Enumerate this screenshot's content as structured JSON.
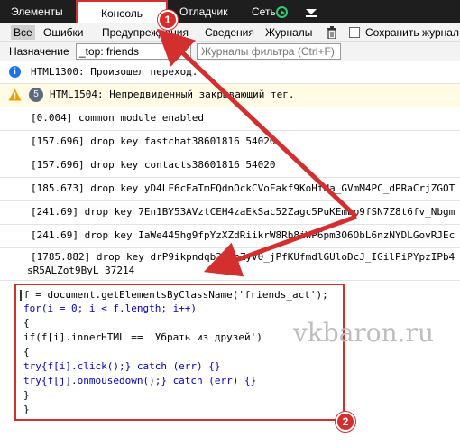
{
  "tabs": {
    "elements": "Элементы",
    "console": "Консоль",
    "debugger": "Отладчик",
    "network": "Сеть"
  },
  "filters": {
    "all": "Все",
    "errors": "Ошибки",
    "warnings": "Предупреждения",
    "info": "Сведения",
    "logs": "Журналы",
    "preserve_log": "Сохранить журнал"
  },
  "target": {
    "label": "Назначение",
    "selected": "_top: friends",
    "filter_placeholder": "Журналы фильтра (Ctrl+F)"
  },
  "messages": [
    {
      "level": "info",
      "text": "HTML1300: Произошел переход."
    },
    {
      "level": "warning",
      "count": "5",
      "text": "HTML1504: Непредвиденный закрывающий тег."
    },
    {
      "text": "[0.004]  common module enabled"
    },
    {
      "text": "[157.696]  drop key fastchat38601816 54020"
    },
    {
      "text": "[157.696]  drop key contacts38601816 54020"
    },
    {
      "text": "[185.673]  drop key yD4LF6cEaTmFQdnOckCVoFakf9KoHfHa_GVmM4PC_dPRaCrjZGOT"
    },
    {
      "text": "[241.69]  drop key 7En1BY53AVztCEH4zaEkSac52Zagc5PuKEmbp9fSN7Z8t6fv_Nbgm"
    },
    {
      "text": "[241.69]  drop key IaWe445hg9fpYzXZdRiikrW8Rb8iWP6pm3O6ObL6nzNYDLGovRJEc"
    },
    {
      "text": "[1785.882]  drop key drP9ikpndqb3b7hZyV0_jPfKUfmdlGUloDcJ_IGilPiPYpzIPb4",
      "text2": "sR5ALZot9ByL 37214"
    }
  ],
  "code": [
    "f = document.getElementsByClassName('friends_act');",
    "for(i = 0; i < f.length; i++)",
    "{",
    "if(f[i].innerHTML == 'Убрать из друзей')",
    "{",
    "try{f[i].click();} catch (err) {}",
    "try{f[j].onmousedown();} catch (err) {}",
    "}",
    "}"
  ],
  "annotations": {
    "step1": "1",
    "step2": "2"
  },
  "watermark": "vkbaron.ru",
  "colors": {
    "annotation": "#d32f2f",
    "accent_green": "#2ecc71",
    "info_blue": "#1a73e8"
  }
}
